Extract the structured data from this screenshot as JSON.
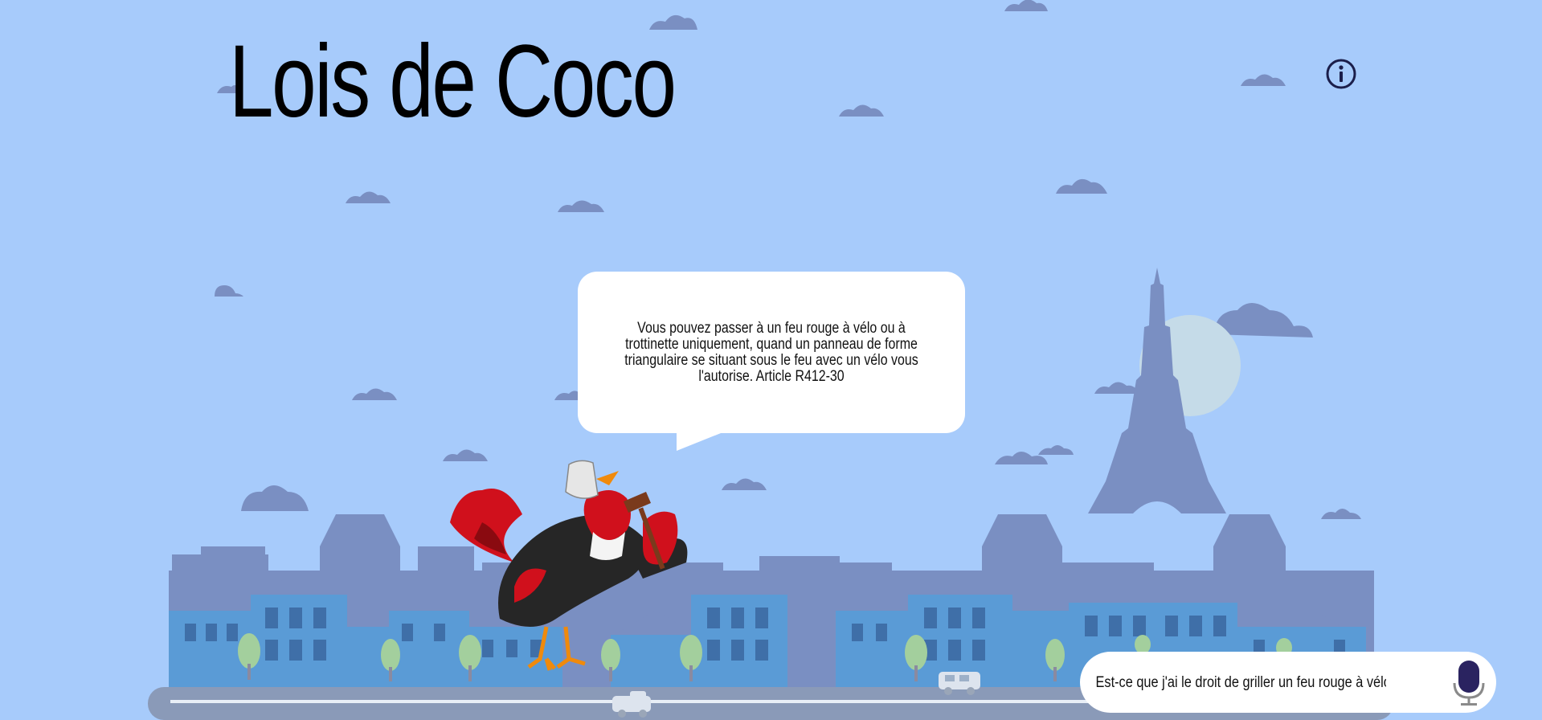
{
  "app": {
    "title": "Lois de Coco"
  },
  "header": {
    "info_icon": "info-circle-icon"
  },
  "assistant": {
    "answer": "Vous pouvez passer à un feu rouge à vélo ou à trottinette uniquement, quand un panneau de forme triangulaire se situant sous le feu avec un vélo vous l'autorise. Article R412-30"
  },
  "query": {
    "value": "Est-ce que j'ai le droit de griller un feu rouge à vélo ?",
    "mic_icon": "microphone-icon"
  },
  "colors": {
    "sky": "#a7cbfb",
    "city": "#7a8fc2",
    "windows": "#5a9bd6",
    "accent": "#2a2360"
  }
}
